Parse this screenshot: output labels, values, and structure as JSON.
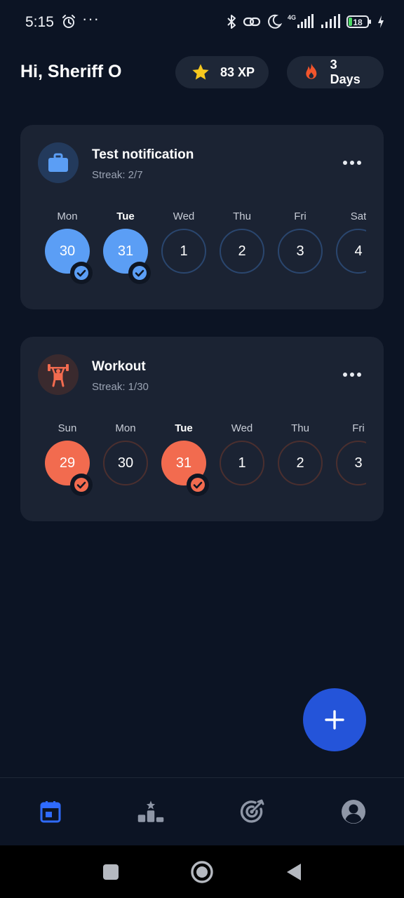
{
  "status_bar": {
    "time": "5:15",
    "dots": "···",
    "battery": "18",
    "network": "4G"
  },
  "header": {
    "greeting": "Hi, Sheriff O",
    "xp_label": "83 XP",
    "streak_label": "3 Days"
  },
  "habits": [
    {
      "title": "Test notification",
      "streak": "Streak: 2/7",
      "icon": "briefcase-icon",
      "color": "#5b9ef5",
      "days": [
        {
          "label": "Mon",
          "date": "30",
          "done": true,
          "bold": false
        },
        {
          "label": "Tue",
          "date": "31",
          "done": true,
          "bold": true
        },
        {
          "label": "Wed",
          "date": "1",
          "done": false,
          "bold": false
        },
        {
          "label": "Thu",
          "date": "2",
          "done": false,
          "bold": false
        },
        {
          "label": "Fri",
          "date": "3",
          "done": false,
          "bold": false
        },
        {
          "label": "Sat",
          "date": "4",
          "done": false,
          "bold": false
        }
      ]
    },
    {
      "title": "Workout",
      "streak": "Streak: 1/30",
      "icon": "weightlifting-icon",
      "color": "#f26b4f",
      "days": [
        {
          "label": "Sun",
          "date": "29",
          "done": true,
          "bold": false
        },
        {
          "label": "Mon",
          "date": "30",
          "done": false,
          "bold": false
        },
        {
          "label": "Tue",
          "date": "31",
          "done": true,
          "bold": true
        },
        {
          "label": "Wed",
          "date": "1",
          "done": false,
          "bold": false
        },
        {
          "label": "Thu",
          "date": "2",
          "done": false,
          "bold": false
        },
        {
          "label": "Fri",
          "date": "3",
          "done": false,
          "bold": false
        }
      ]
    }
  ],
  "bottom_nav": {
    "items": [
      {
        "icon": "calendar-icon",
        "active": true
      },
      {
        "icon": "leaderboard-icon",
        "active": false
      },
      {
        "icon": "target-icon",
        "active": false
      },
      {
        "icon": "profile-icon",
        "active": false
      }
    ]
  },
  "colors": {
    "background": "#0c1424",
    "card": "#1b2333",
    "accent_blue": "#5b9ef5",
    "accent_orange": "#f26b4f",
    "fab": "#2454d9",
    "nav_active": "#2f6bff"
  }
}
